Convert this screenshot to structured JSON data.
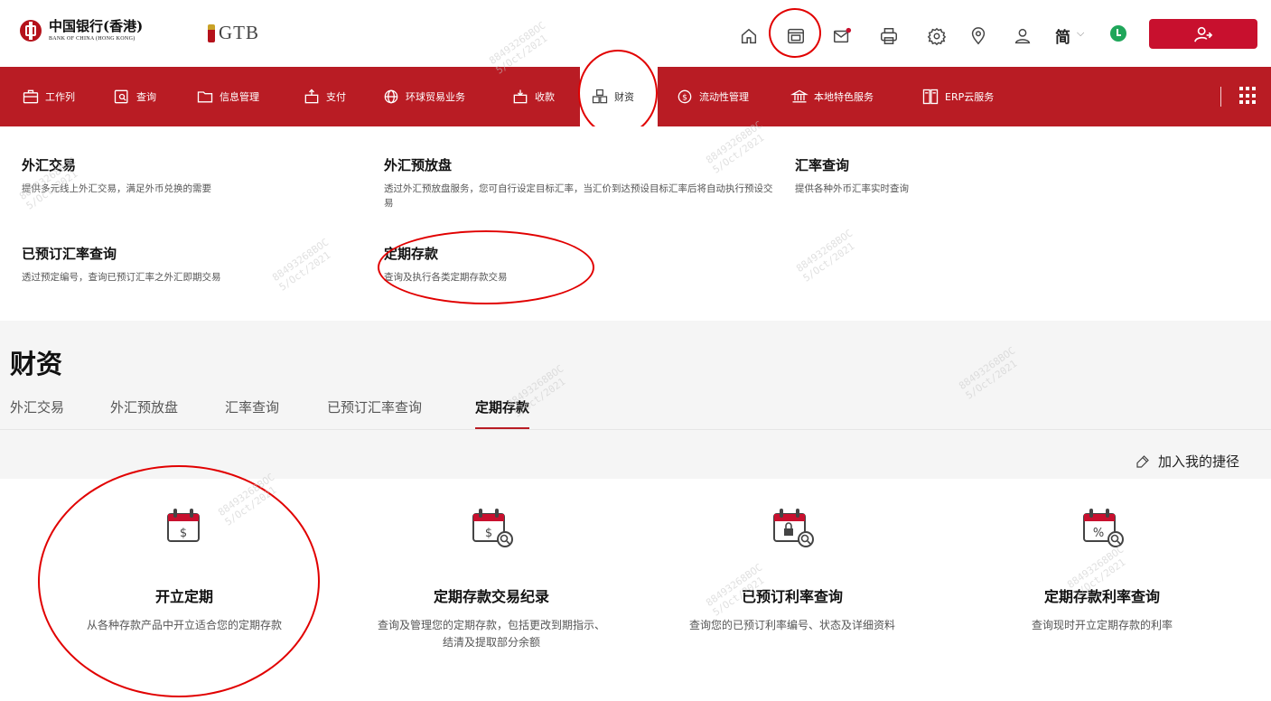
{
  "header": {
    "logo_cn": "中国银行(香港)",
    "logo_en": "BANK OF CHINA (HONG KONG)",
    "gtb_logo": "GTB",
    "icons": [
      "home-icon",
      "dashboard-icon",
      "mail-icon",
      "print-icon",
      "settings-icon",
      "location-icon",
      "user-icon"
    ],
    "language": "简",
    "logout_icon": "logout-icon"
  },
  "nav": {
    "items": [
      {
        "label": "工作列",
        "icon": "briefcase-icon"
      },
      {
        "label": "查询",
        "icon": "search-doc-icon"
      },
      {
        "label": "信息管理",
        "icon": "folder-icon"
      },
      {
        "label": "支付",
        "icon": "payment-icon"
      },
      {
        "label": "环球贸易业务",
        "icon": "globe-trade-icon"
      },
      {
        "label": "收款",
        "icon": "receive-icon"
      },
      {
        "label": "财资",
        "icon": "treasury-icon"
      },
      {
        "label": "流动性管理",
        "icon": "liquidity-icon"
      },
      {
        "label": "本地特色服务",
        "icon": "bank-building-icon"
      },
      {
        "label": "ERP云服务",
        "icon": "erp-icon"
      }
    ],
    "active": "财资"
  },
  "dropdown": {
    "items": [
      {
        "title": "外汇交易",
        "desc": "提供多元线上外汇交易，满足外币兑换的需要"
      },
      {
        "title": "外汇预放盘",
        "desc": "透过外汇预放盘服务，您可自行设定目标汇率，当汇价到达预设目标汇率后将自动执行预设交易"
      },
      {
        "title": "汇率查询",
        "desc": "提供各种外币汇率实时查询"
      },
      {
        "title": "已预订汇率查询",
        "desc": "透过预定编号，查询已预订汇率之外汇即期交易"
      },
      {
        "title": "定期存款",
        "desc": "查询及执行各类定期存款交易"
      }
    ]
  },
  "page": {
    "title": "财资",
    "tabs": [
      "外汇交易",
      "外汇预放盘",
      "汇率查询",
      "已预订汇率查询",
      "定期存款"
    ],
    "active_tab": "定期存款",
    "shortcut_label": "加入我的捷径",
    "cards": [
      {
        "title": "开立定期",
        "desc": "从各种存款产品中开立适合您的定期存款",
        "icon": "calendar-dollar-icon"
      },
      {
        "title": "定期存款交易纪录",
        "desc": "查询及管理您的定期存款，包括更改到期指示、结清及提取部分余额",
        "icon": "calendar-dollar-search-icon"
      },
      {
        "title": "已预订利率查询",
        "desc": "查询您的已预订利率编号、状态及详细资料",
        "icon": "calendar-lock-search-icon"
      },
      {
        "title": "定期存款利率查询",
        "desc": "查询现时开立定期存款的利率",
        "icon": "calendar-percent-search-icon"
      }
    ]
  },
  "colors": {
    "brand_red": "#b91c24",
    "annotation_red": "#e10000",
    "status_green": "#1fa65a"
  }
}
